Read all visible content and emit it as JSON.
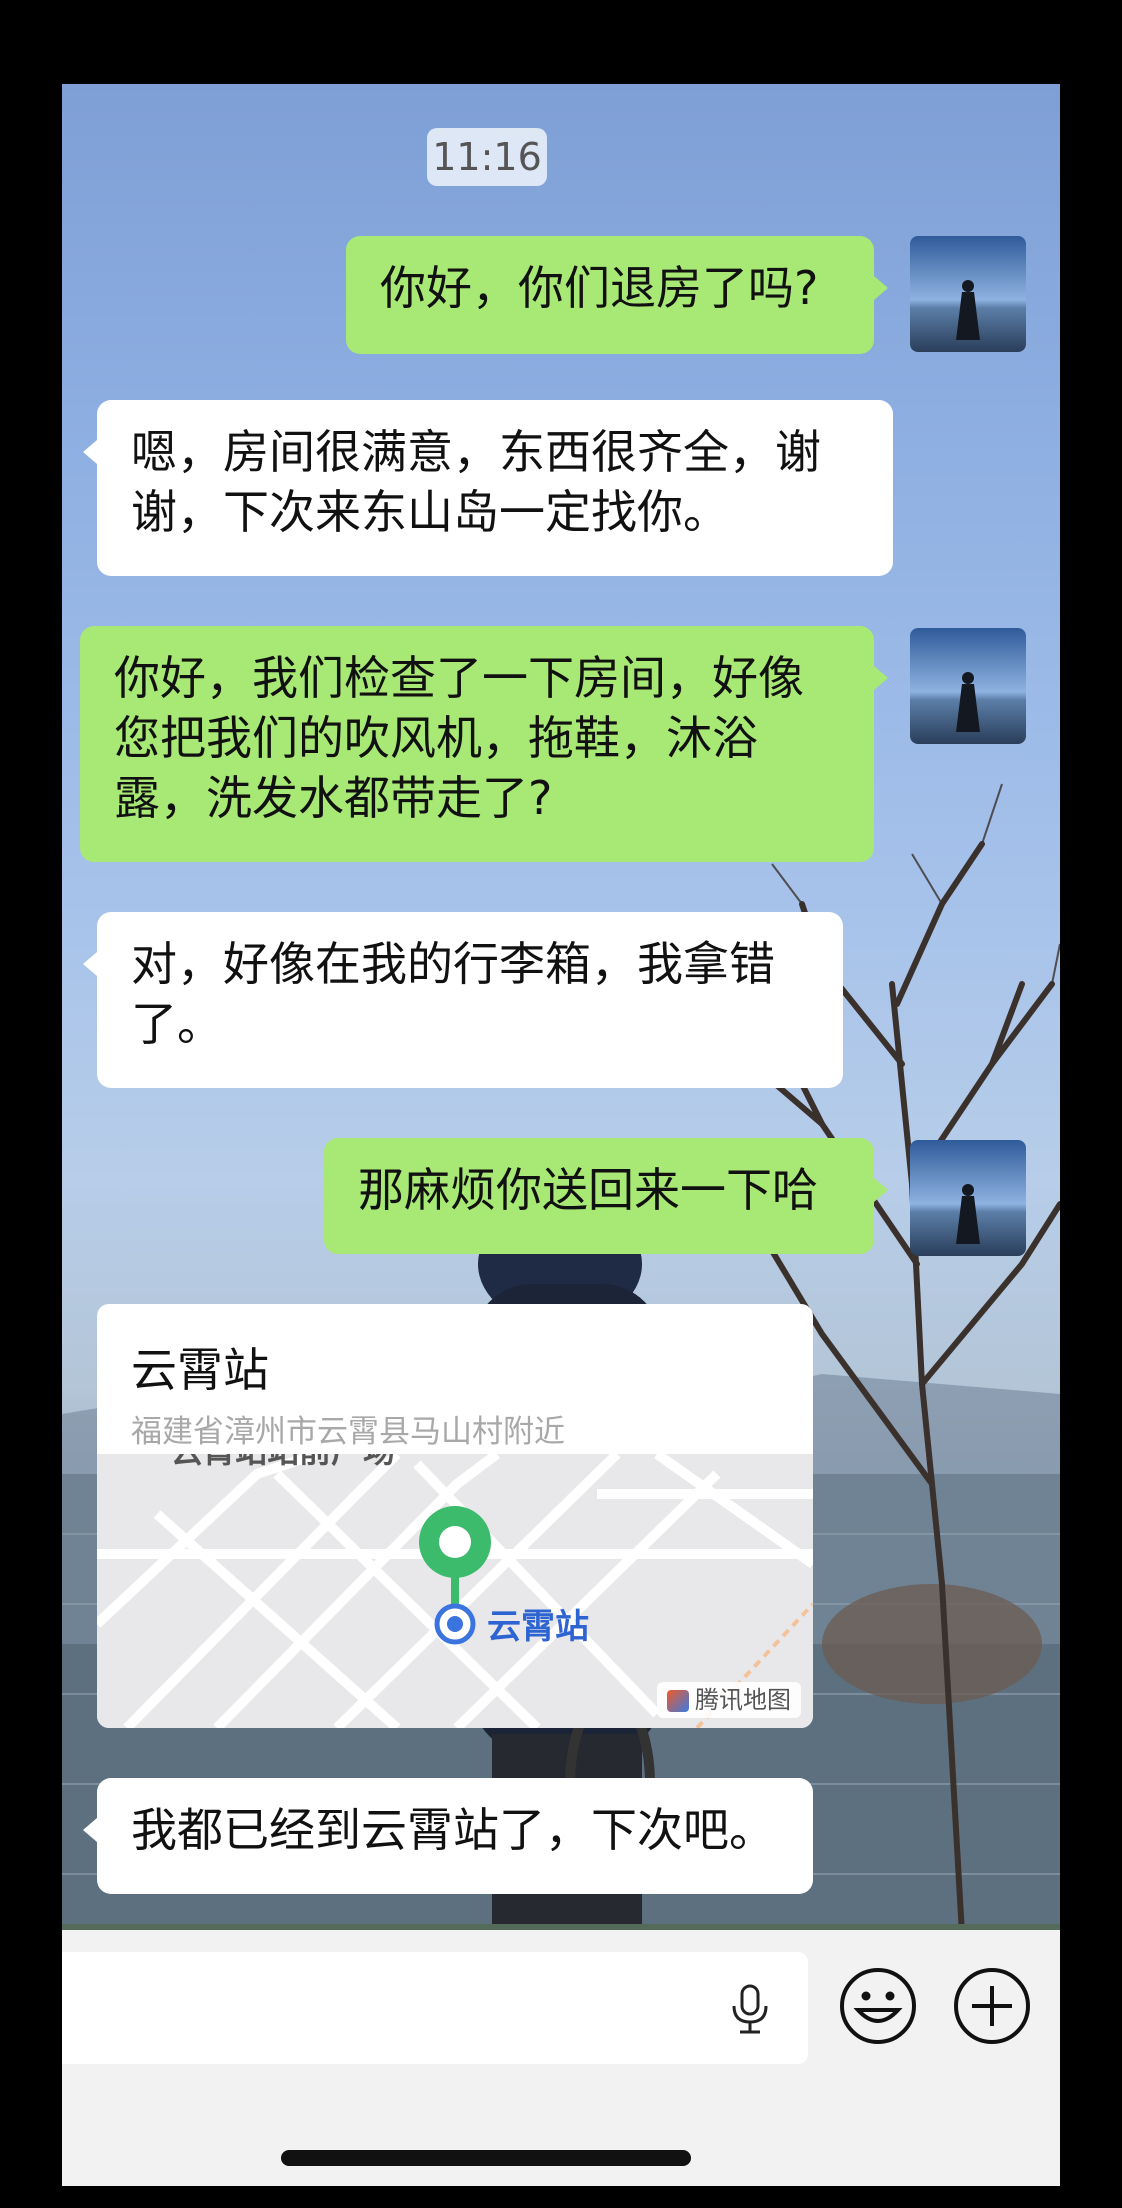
{
  "chat": {
    "timestamp": "11:16",
    "messages": [
      {
        "side": "right",
        "text": "你好，你们退房了吗?"
      },
      {
        "side": "left",
        "text": "嗯，房间很满意，东西很齐全，谢谢，下次来东山岛一定找你。"
      },
      {
        "side": "right",
        "text": "你好，我们检查了一下房间，好像您把我们的吹风机，拖鞋，沐浴露，洗发水都带走了?"
      },
      {
        "side": "left",
        "text": "对，好像在我的行李箱，我拿错了。"
      },
      {
        "side": "right",
        "text": "那麻烦你送回来一下哈"
      },
      {
        "side": "left",
        "text": "我都已经到云霄站了，下次吧。"
      }
    ],
    "location": {
      "title": "云霄站",
      "address": "福建省漳州市云霄县马山村附近",
      "map_top_label": "云霄站站前广场",
      "map_pin_label": "云霄站",
      "attribution": "腾讯地图"
    }
  },
  "icons": {
    "mic": "microphone-icon",
    "emoji": "emoji-icon",
    "plus": "plus-icon"
  },
  "colors": {
    "outgoing_bubble": "#a8e874",
    "incoming_bubble": "#ffffff",
    "map_pin": "#3dbb6c",
    "map_label": "#2e63d2"
  }
}
